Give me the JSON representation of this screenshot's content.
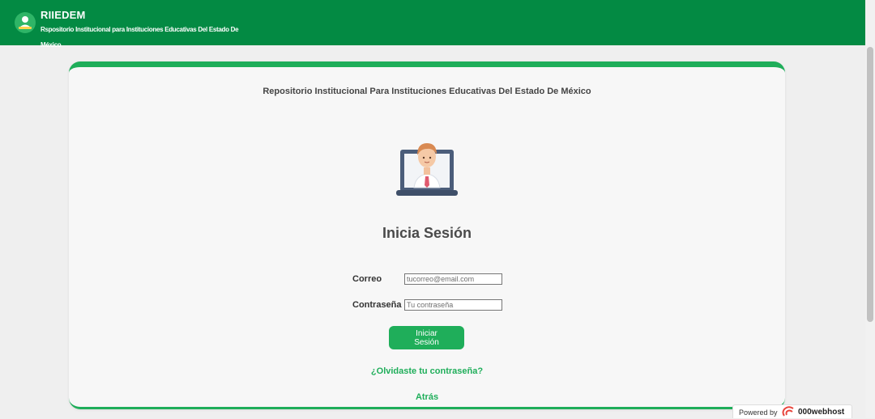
{
  "header": {
    "brand": "RIIEDEM",
    "subtitle": "Rspositorio Institucional para Instituciones Educativas Del Estado De México",
    "logo_icon": "user-group-icon"
  },
  "card": {
    "title": "Repositorio Institucional Para Instituciones Educativas Del Estado De México",
    "illustration_icon": "user-laptop-icon",
    "heading": "Inicia Sesión"
  },
  "form": {
    "email_label": "Correo",
    "email_placeholder": "tucorreo@email.com",
    "password_label": "Contraseña",
    "password_placeholder": "Tu contraseña",
    "submit_label": "Iniciar Sesión",
    "forgot_link": "¿Olvidaste tu contraseña?",
    "back_link": "Atrás"
  },
  "footer_badge": {
    "powered_by": "Powered by",
    "brand": "000webhost"
  },
  "colors": {
    "header": "#038a43",
    "accent": "#1fae5a",
    "background": "#efefef"
  }
}
